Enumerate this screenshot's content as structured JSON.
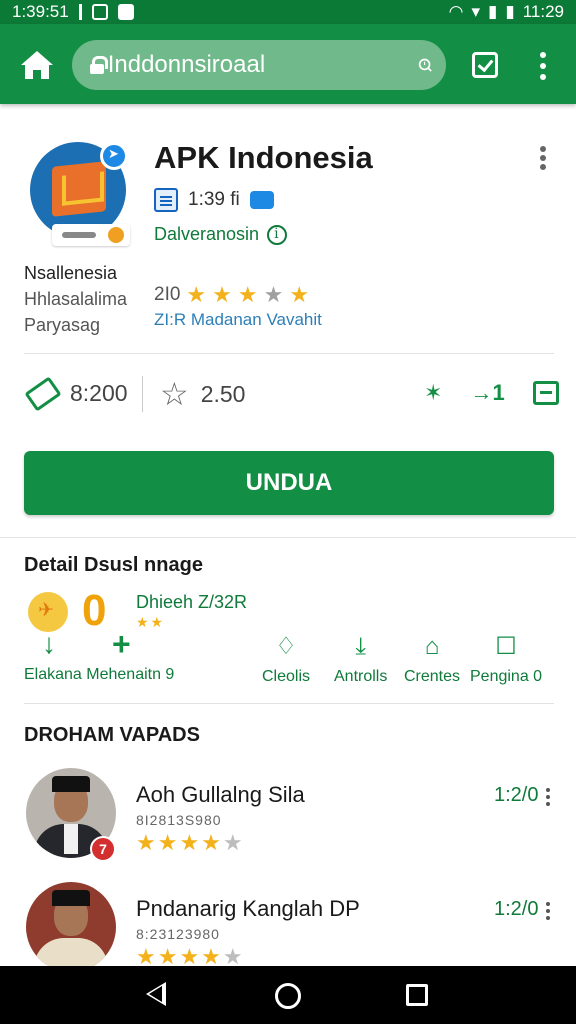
{
  "status_bar": {
    "time_left": "1:39:51",
    "time_right": "11:29"
  },
  "browser": {
    "url_text": "Inddonnsiroaal"
  },
  "app": {
    "title": "APK Indonesia",
    "meta_text": "1:39 fi",
    "developer_link": "Dalveranosin",
    "left_name": "Nsallenesia",
    "left_line2": "Hhlasalalima",
    "left_line3": "Paryasag",
    "rating_value": "2I0",
    "rating_stars": 4,
    "rating_sub": "ZI:R Madanan Vavahit"
  },
  "stats": {
    "tag_value": "8:200",
    "star_value": "2.50",
    "action_value": "1"
  },
  "install_button": {
    "label": "UNDUA"
  },
  "details": {
    "section_title": "Detail Dsusl nnage",
    "big_value": "0",
    "heading": "Dhieeh Z/32R",
    "left_label": "Elakana Mehenaitn 9",
    "items": [
      {
        "label": "Cleolis"
      },
      {
        "label": "Antrolls"
      },
      {
        "label": "Crentes"
      },
      {
        "label": "Pengina  0"
      }
    ]
  },
  "reviews": {
    "section_title": "DROHAM VAPADS",
    "items": [
      {
        "title": "Aoh Gullalng Sila",
        "subtitle": "8I2813S980",
        "stars": 4,
        "count": "1:2/0",
        "badge": "7"
      },
      {
        "title": "Pndanarig Kanglah DP",
        "subtitle": "8:23123980",
        "stars": 4,
        "count": "1:2/0"
      }
    ]
  },
  "colors": {
    "primary_green": "#138f45",
    "status_green": "#0c7a37",
    "star_yellow": "#f3b21b",
    "link_blue": "#2d7fb8"
  }
}
